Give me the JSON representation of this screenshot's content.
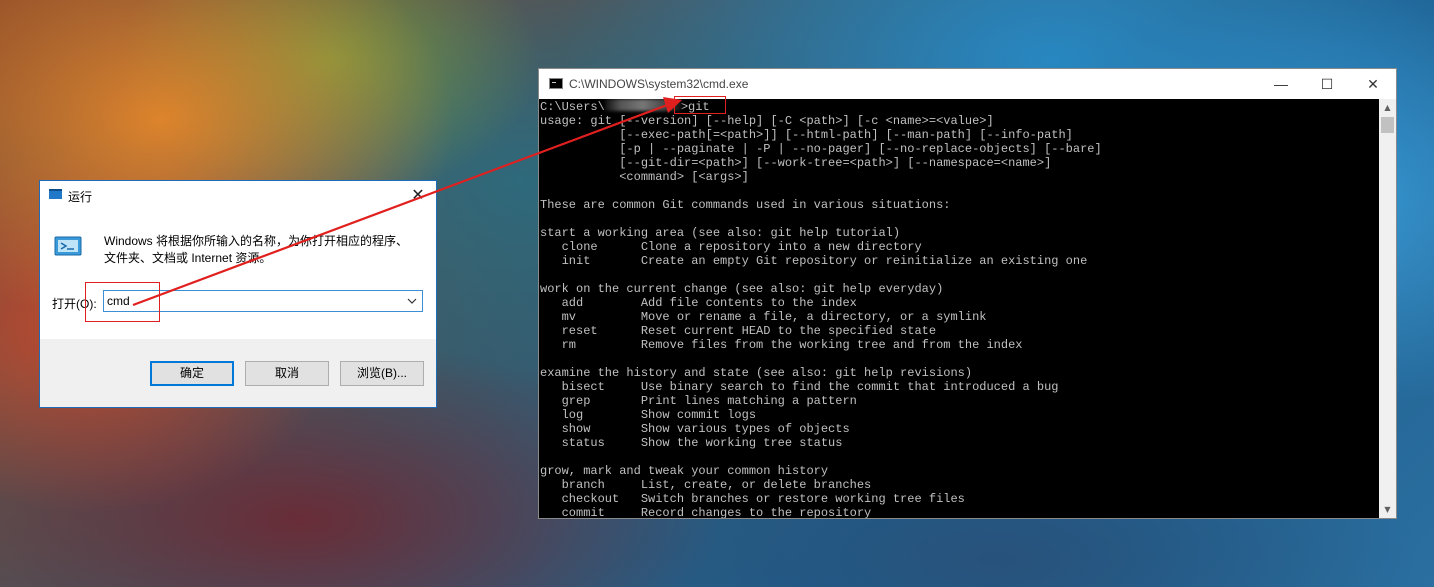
{
  "run_dialog": {
    "title": "运行",
    "close_glyph": "✕",
    "description_line1": "Windows 将根据你所输入的名称，为你打开相应的程序、",
    "description_line2": "文件夹、文档或 Internet 资源。",
    "open_label": "打开(O):",
    "input_value": "cmd",
    "ok_label": "确定",
    "cancel_label": "取消",
    "browse_label": "浏览(B)...",
    "icons": [
      "run-icon",
      "chevron-down-icon",
      "close-icon"
    ]
  },
  "cmd_window": {
    "title": "C:\\WINDOWS\\system32\\cmd.exe",
    "controls": {
      "minimize": "—",
      "maximize": "☐",
      "close": "✕"
    },
    "prompt_prefix": "C:\\Users\\",
    "prompt_suffix": ">git",
    "output_lines": [
      "usage: git [--version] [--help] [-C <path>] [-c <name>=<value>]",
      "           [--exec-path[=<path>]] [--html-path] [--man-path] [--info-path]",
      "           [-p | --paginate | -P | --no-pager] [--no-replace-objects] [--bare]",
      "           [--git-dir=<path>] [--work-tree=<path>] [--namespace=<name>]",
      "           <command> [<args>]",
      "",
      "These are common Git commands used in various situations:",
      "",
      "start a working area (see also: git help tutorial)",
      "   clone      Clone a repository into a new directory",
      "   init       Create an empty Git repository or reinitialize an existing one",
      "",
      "work on the current change (see also: git help everyday)",
      "   add        Add file contents to the index",
      "   mv         Move or rename a file, a directory, or a symlink",
      "   reset      Reset current HEAD to the specified state",
      "   rm         Remove files from the working tree and from the index",
      "",
      "examine the history and state (see also: git help revisions)",
      "   bisect     Use binary search to find the commit that introduced a bug",
      "   grep       Print lines matching a pattern",
      "   log        Show commit logs",
      "   show       Show various types of objects",
      "   status     Show the working tree status",
      "",
      "grow, mark and tweak your common history",
      "   branch     List, create, or delete branches",
      "   checkout   Switch branches or restore working tree files",
      "   commit     Record changes to the repository"
    ],
    "colors": {
      "console_bg": "#000000",
      "console_fg": "#c0c0c0"
    }
  },
  "annotations": {
    "color": "#e0201f"
  }
}
